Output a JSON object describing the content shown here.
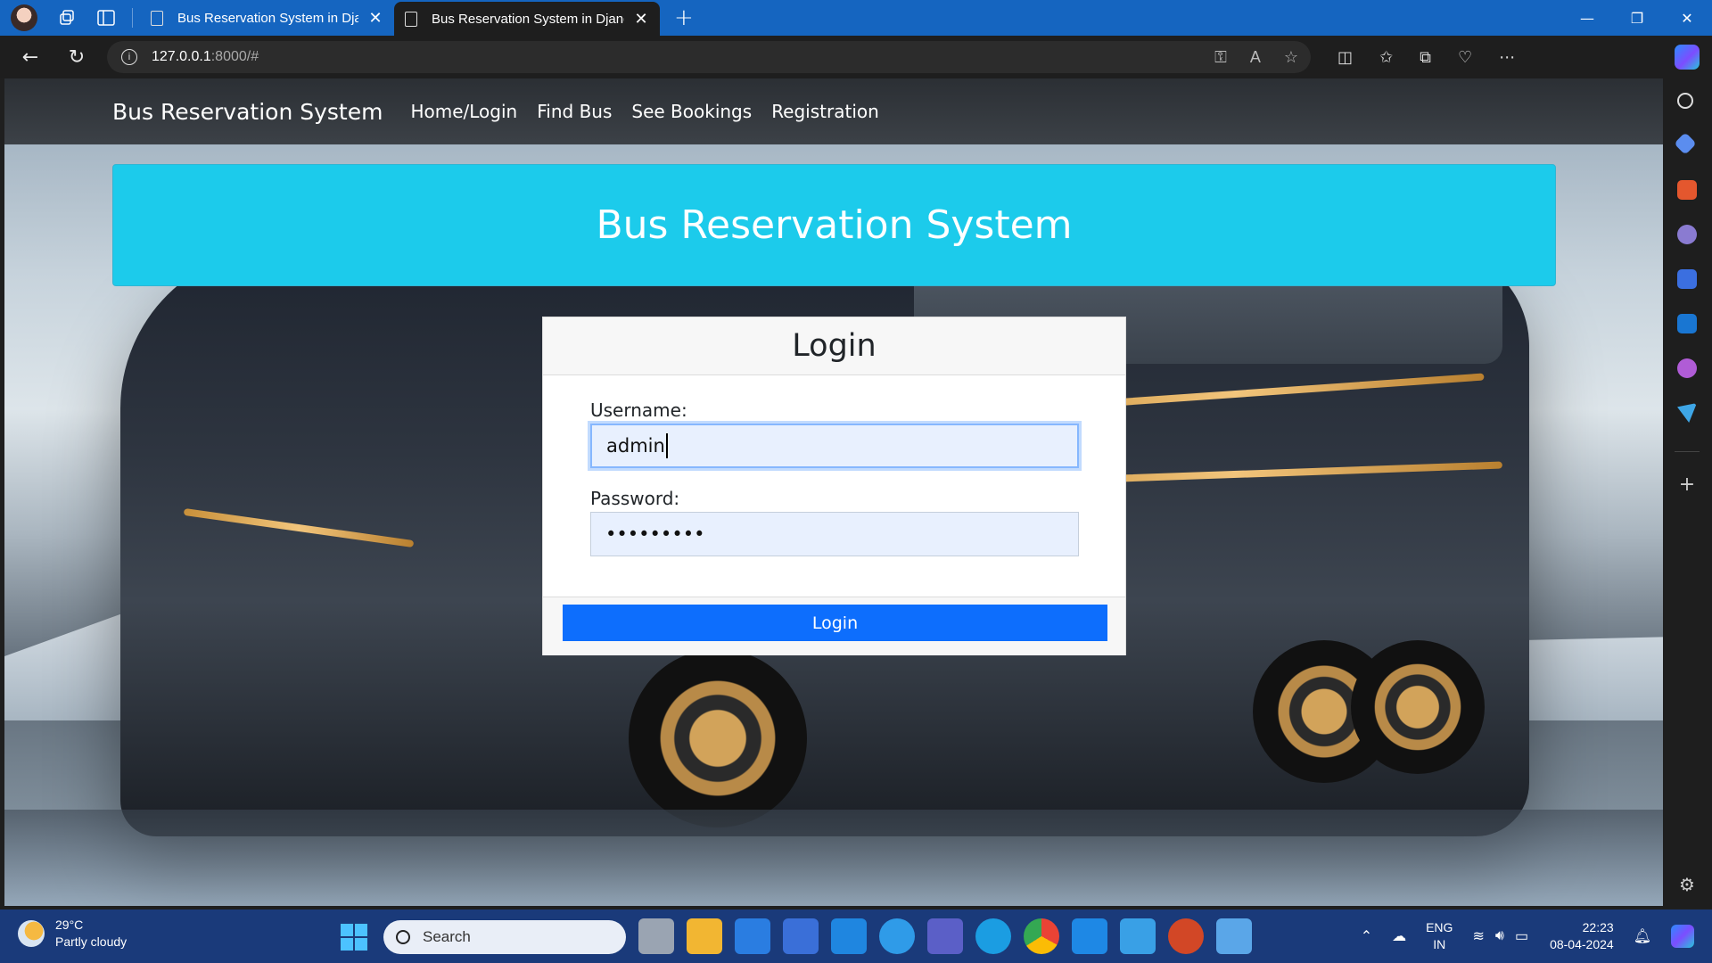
{
  "browser": {
    "tabs": [
      {
        "title": "Bus Reservation System in Djang",
        "active": false
      },
      {
        "title": "Bus Reservation System in Djang",
        "active": true
      }
    ],
    "url_host": "127.0.0.1",
    "url_path": ":8000/#"
  },
  "site": {
    "brand": "Bus Reservation System",
    "nav": [
      "Home/Login",
      "Find Bus",
      "See Bookings",
      "Registration"
    ],
    "hero_title": "Bus Reservation System"
  },
  "login": {
    "heading": "Login",
    "username_label": "Username:",
    "username_value": "admin",
    "password_label": "Password:",
    "password_value": "•••••••••",
    "button_label": "Login"
  },
  "taskbar": {
    "temp": "29°C",
    "weather": "Partly cloudy",
    "search_placeholder": "Search",
    "lang_top": "ENG",
    "lang_bottom": "IN",
    "time": "22:23",
    "date": "08-04-2024"
  },
  "colors": {
    "accent_blue": "#0d6efd",
    "hero_cyan": "#1ccbeb",
    "titlebar": "#1565c0"
  }
}
